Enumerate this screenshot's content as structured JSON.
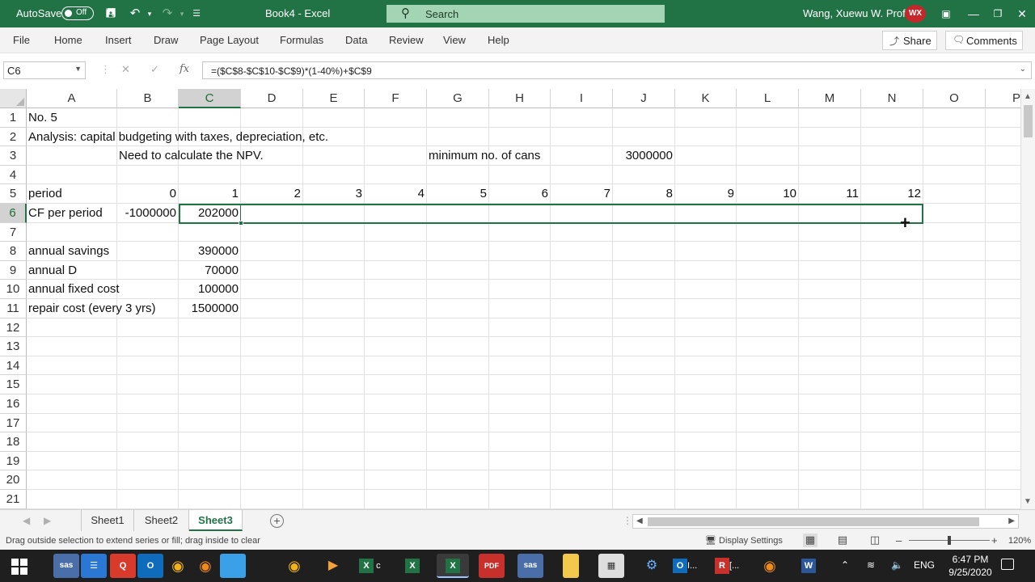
{
  "titlebar": {
    "autosave_label": "AutoSave",
    "autosave_state": "Off",
    "doc_title": "Book4  -  Excel",
    "search_placeholder": "Search",
    "user_name": "Wang, Xuewu W. Prof.",
    "user_initials": "WX",
    "accent": "#217346"
  },
  "ribbon": {
    "tabs": [
      "File",
      "Home",
      "Insert",
      "Draw",
      "Page Layout",
      "Formulas",
      "Data",
      "Review",
      "View",
      "Help"
    ],
    "share_label": "Share",
    "comments_label": "Comments"
  },
  "formula_bar": {
    "name_box": "C6",
    "fx_label": "fx",
    "formula": "=($C$8-$C$10-$C$9)*(1-40%)+$C$9"
  },
  "grid": {
    "columns": [
      "A",
      "B",
      "C",
      "D",
      "E",
      "F",
      "G",
      "H",
      "I",
      "J",
      "K",
      "L",
      "M",
      "N",
      "O",
      "P"
    ],
    "rows": [
      "1",
      "2",
      "3",
      "4",
      "5",
      "6",
      "7",
      "8",
      "9",
      "10",
      "11",
      "12",
      "13",
      "14",
      "15",
      "16",
      "17",
      "18",
      "19",
      "20",
      "21"
    ],
    "selected_column": "C",
    "selected_row": "6",
    "cells": {
      "A1": "No. 5",
      "A2": "Analysis:  capital budgeting with taxes, depreciation, etc.",
      "B3": "Need to calculate the NPV.",
      "G3": "minimum no. of cans",
      "J3": "3000000",
      "A5": "period",
      "B5": "0",
      "C5": "1",
      "D5": "2",
      "E5": "3",
      "F5": "4",
      "G5": "5",
      "H5": "6",
      "I5": "7",
      "J5": "8",
      "K5": "9",
      "L5": "10",
      "M5": "11",
      "N5": "12",
      "A6": "CF per period",
      "B6": "-1000000",
      "C6": "202000",
      "A8": "annual savings",
      "C8": "390000",
      "A9": "annual D",
      "C9": "70000",
      "A10": "annual fixed cost",
      "C10": "100000",
      "A11": "repair cost (every 3 yrs)",
      "C11": "1500000"
    }
  },
  "sheets": {
    "tabs": [
      "Sheet1",
      "Sheet2",
      "Sheet3"
    ],
    "active": "Sheet3"
  },
  "status": {
    "message": "Drag outside selection to extend series or fill; drag inside to clear",
    "display_settings": "Display Settings",
    "zoom": "120%",
    "zoom_level_percent": 120
  },
  "taskbar": {
    "apps": [
      "sas",
      "files",
      "quicken",
      "outlook",
      "chrome",
      "firefox",
      "folder",
      "chrome-2",
      "media",
      "excel-c",
      "excel-2",
      "excel-active",
      "pdf",
      "sas-2",
      "notes",
      "screen",
      "network",
      "outlook-l",
      "r-app",
      "firefox-2",
      "word"
    ],
    "excel_c_label": "c",
    "outlook_label": "I...",
    "r_label": "[...",
    "language": "ENG",
    "time": "6:47 PM",
    "date": "9/25/2020"
  }
}
